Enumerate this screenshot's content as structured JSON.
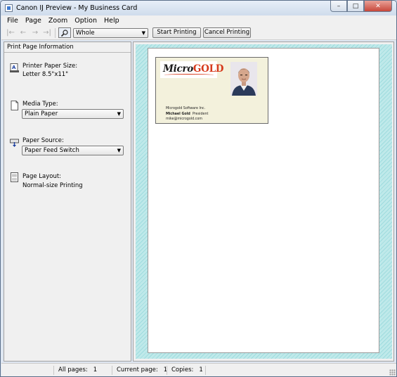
{
  "window": {
    "title": "Canon IJ Preview - My Business Card",
    "controls": {
      "minimize": "–",
      "maximize": "□",
      "close": "✕"
    }
  },
  "menu": {
    "items": [
      "File",
      "Page",
      "Zoom",
      "Option",
      "Help"
    ]
  },
  "toolbar": {
    "nav_first": "|←",
    "nav_prev": "←",
    "nav_next": "→",
    "nav_last": "→|",
    "zoom_value": "Whole",
    "start_printing": "Start Printing",
    "cancel_printing": "Cancel Printing"
  },
  "left_panel": {
    "header": "Print Page Information",
    "paper_size_label": "Printer Paper Size:",
    "paper_size_value": "Letter 8.5\"x11\"",
    "media_type_label": "Media Type:",
    "media_type_value": "Plain Paper",
    "paper_source_label": "Paper Source:",
    "paper_source_value": "Paper Feed Switch",
    "page_layout_label": "Page Layout:",
    "page_layout_value": "Normal-size Printing"
  },
  "card": {
    "logo_micro": "Micro",
    "logo_gold": "GOLD",
    "company": "Microgold Software Inc.",
    "name": "Michael Gold",
    "role": "President",
    "email": "mike@microgold.com"
  },
  "status": {
    "all_pages_label": "All pages:",
    "all_pages_value": "1",
    "current_page_label": "Current page:",
    "current_page_value": "1",
    "copies_label": "Copies:",
    "copies_value": "1"
  }
}
